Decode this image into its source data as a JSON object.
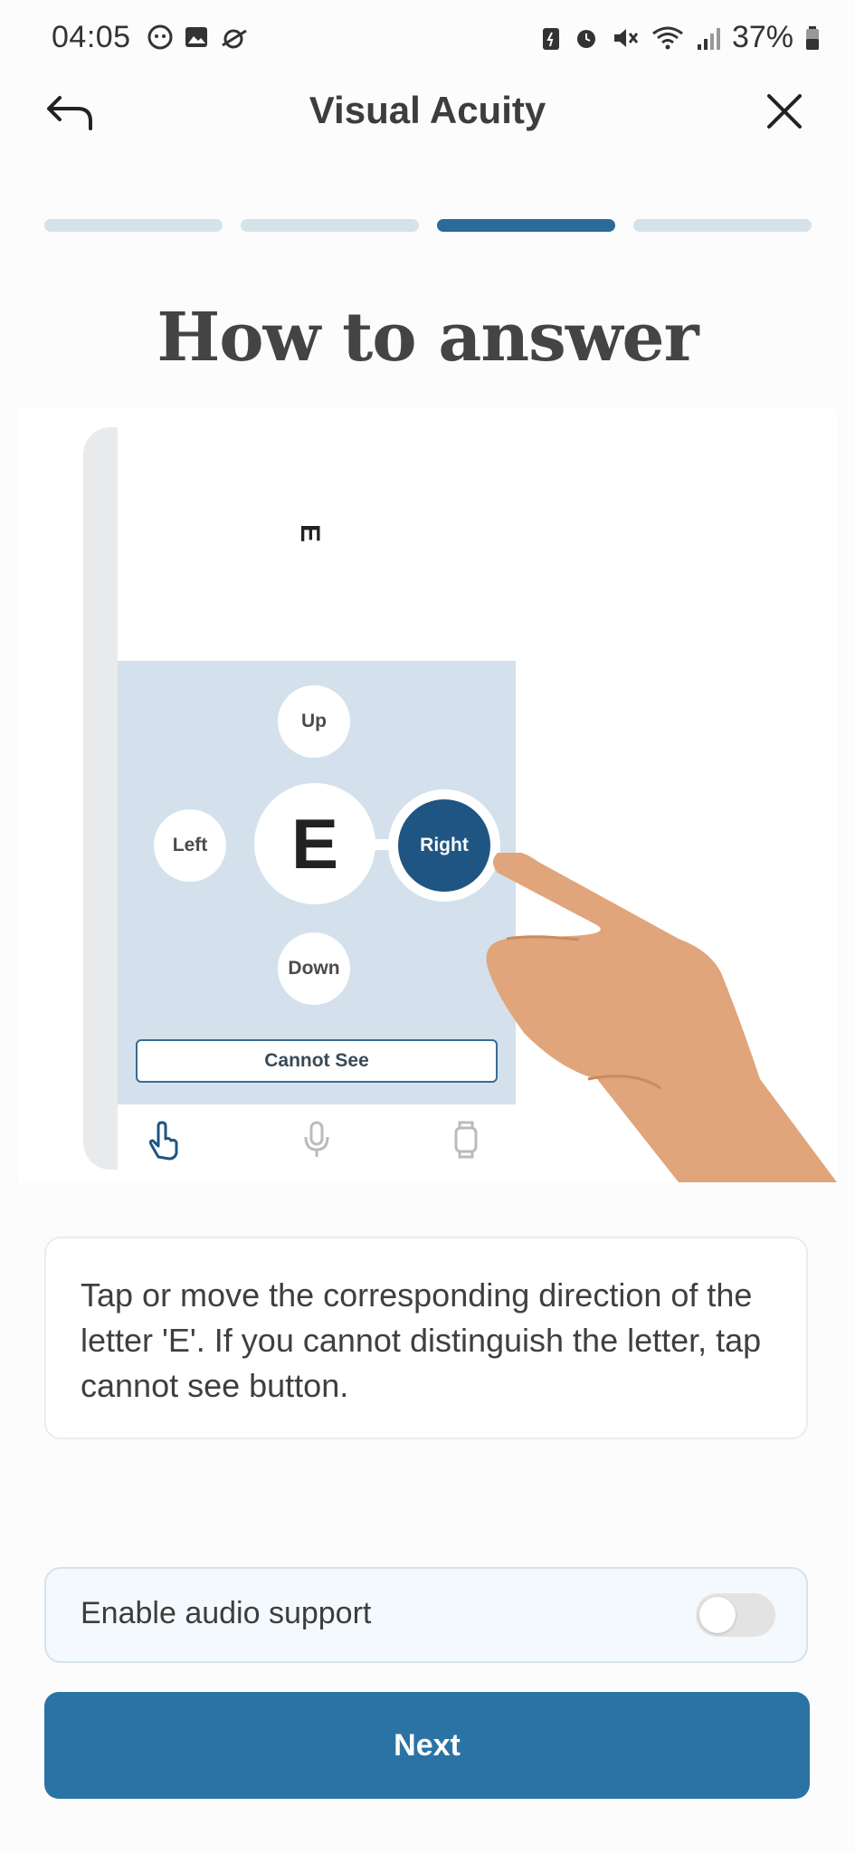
{
  "status_bar": {
    "time": "04:05",
    "battery": "37%",
    "left_icons": [
      "face-icon",
      "gallery-icon",
      "notification-icon"
    ],
    "right_icons": [
      "battery-saver-icon",
      "alarm-icon",
      "mute-icon",
      "wifi-icon",
      "signal-icon",
      "battery-icon"
    ]
  },
  "header": {
    "title": "Visual Acuity",
    "back_icon": "back-arrow-icon",
    "close_icon": "close-icon"
  },
  "progress": {
    "total_steps": 4,
    "current_step": 3
  },
  "heading": "How to answer",
  "illustration": {
    "target_letter": "E",
    "up_label": "Up",
    "down_label": "Down",
    "left_label": "Left",
    "center_letter": "E",
    "right_label": "Right",
    "cannot_see_label": "Cannot See",
    "tab_icons": [
      "touch-icon",
      "microphone-icon",
      "watch-icon"
    ]
  },
  "description": "Tap or move the corresponding direction of the letter 'E'. If you cannot distinguish the letter, tap cannot see button.",
  "audio": {
    "label": "Enable audio support",
    "enabled": false
  },
  "next_label": "Next",
  "colors": {
    "primary": "#2b73a5",
    "progress_active": "#2a6b9a",
    "progress_inactive": "#d5e2ea"
  }
}
